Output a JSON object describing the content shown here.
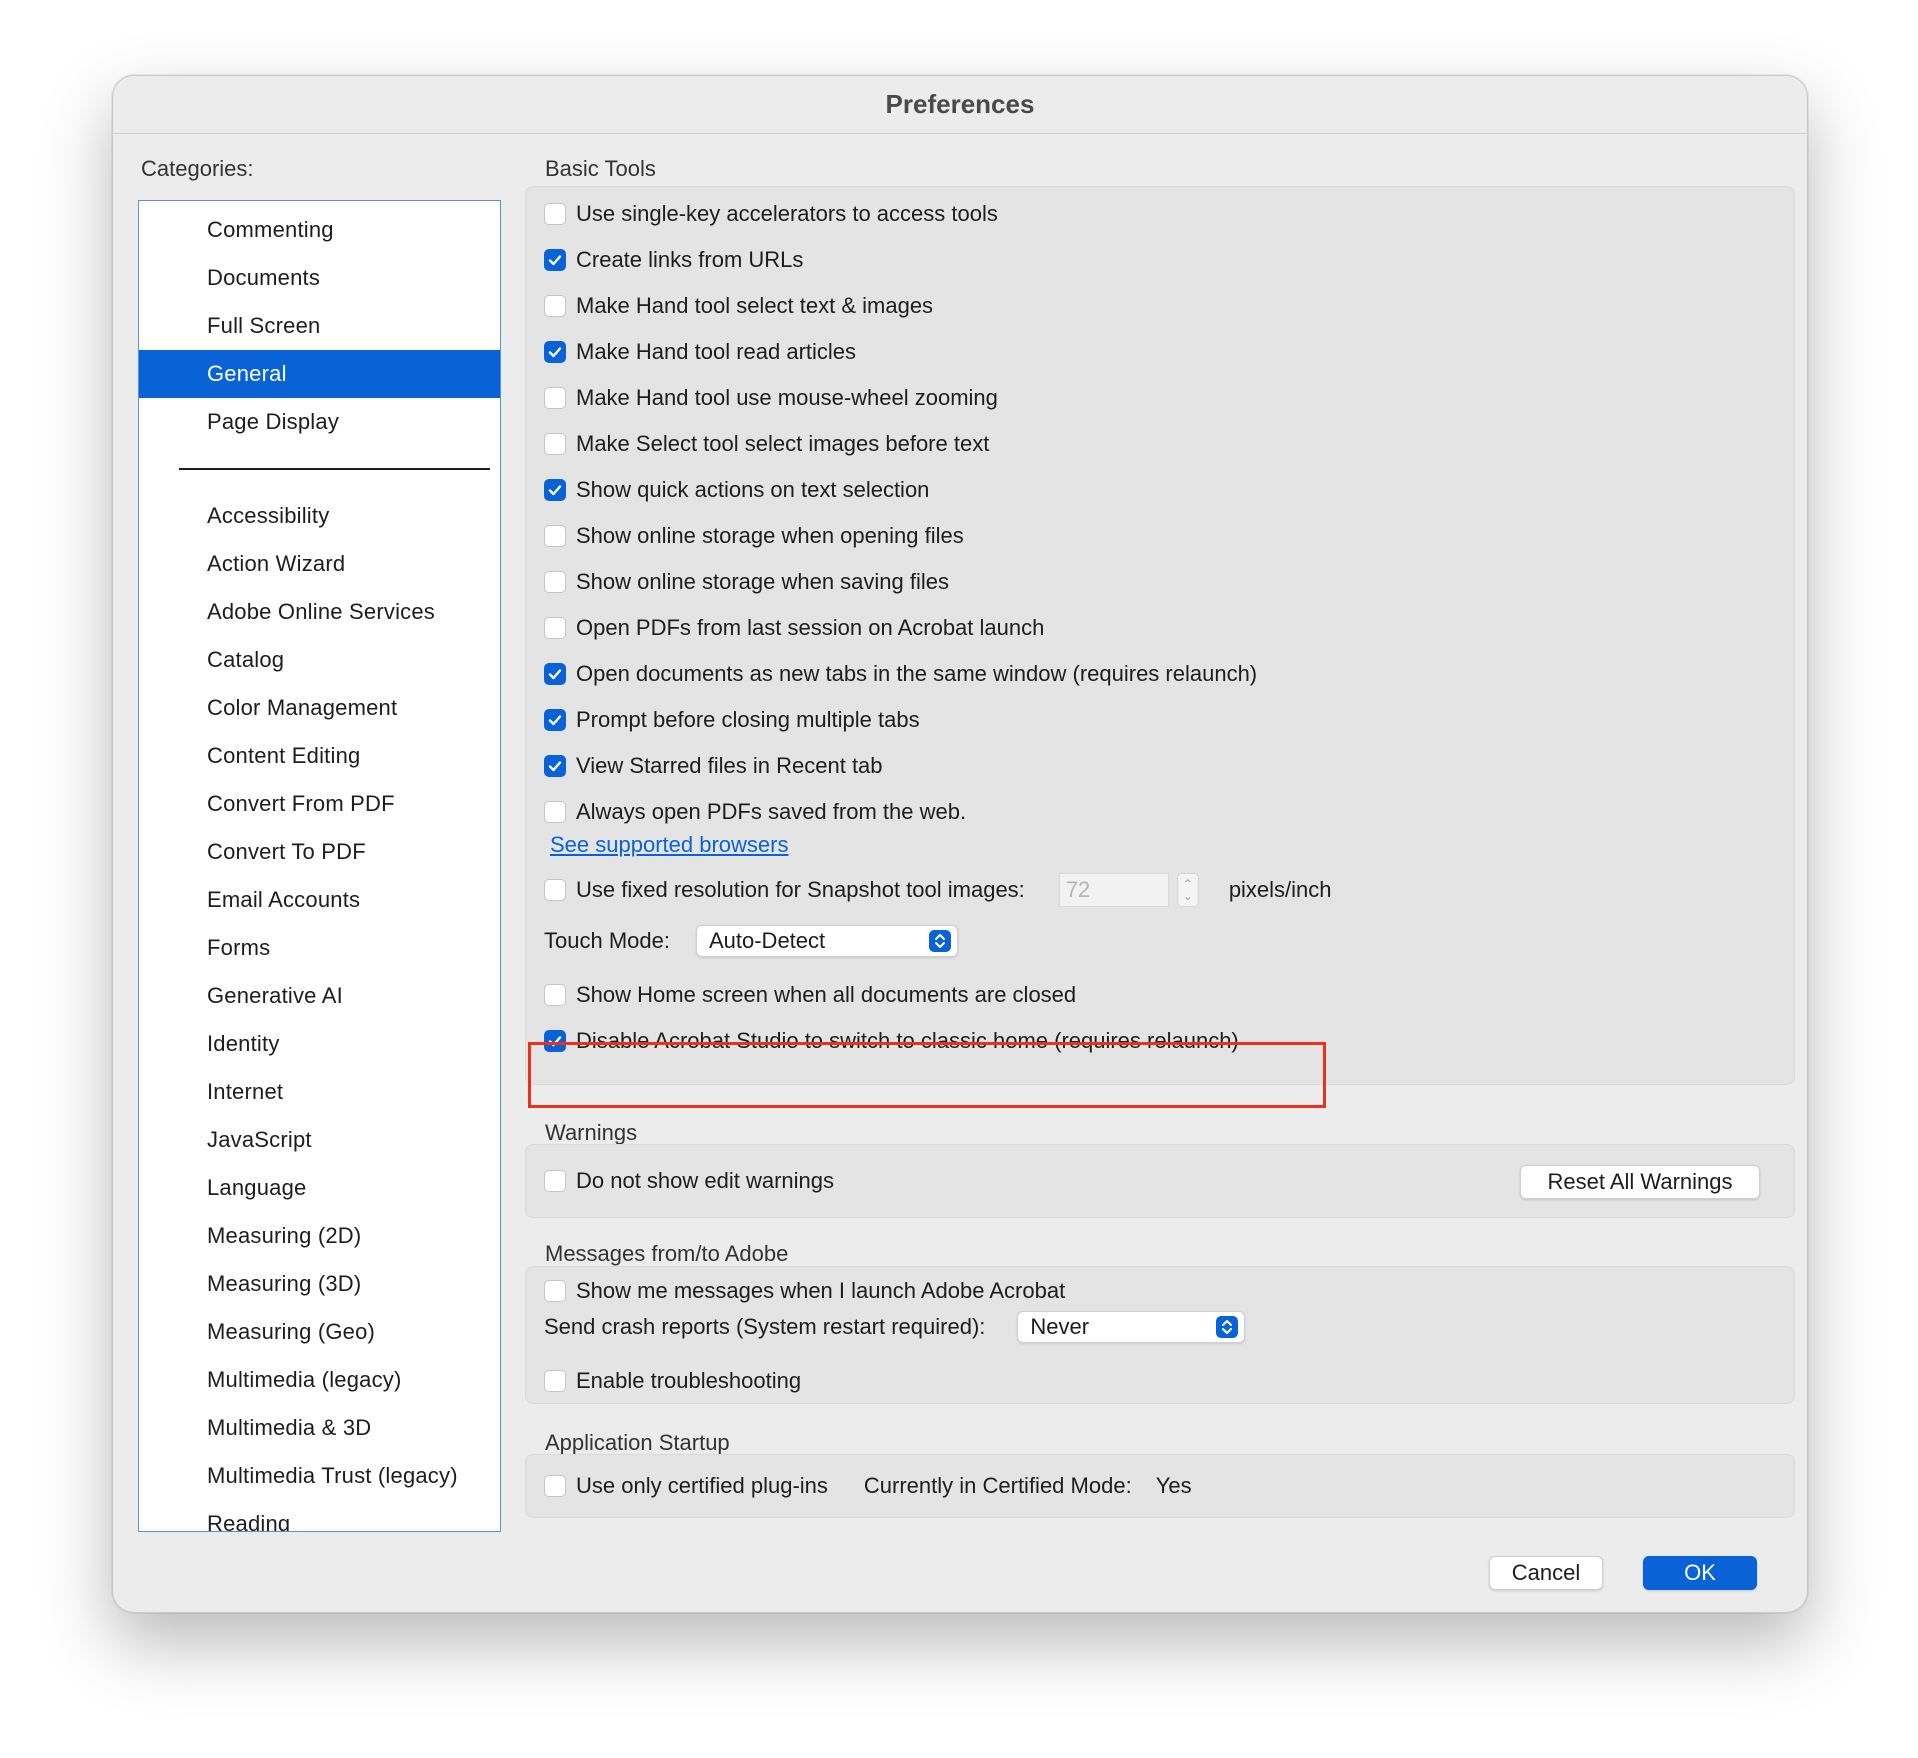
{
  "window": {
    "title": "Preferences"
  },
  "categories": {
    "label": "Categories:",
    "top_items": [
      {
        "label": "Commenting",
        "selected": false
      },
      {
        "label": "Documents",
        "selected": false
      },
      {
        "label": "Full Screen",
        "selected": false
      },
      {
        "label": "General",
        "selected": true
      },
      {
        "label": "Page Display",
        "selected": false
      }
    ],
    "items": [
      {
        "label": "Accessibility"
      },
      {
        "label": "Action Wizard"
      },
      {
        "label": "Adobe Online Services"
      },
      {
        "label": "Catalog"
      },
      {
        "label": "Color Management"
      },
      {
        "label": "Content Editing"
      },
      {
        "label": "Convert From PDF"
      },
      {
        "label": "Convert To PDF"
      },
      {
        "label": "Email Accounts"
      },
      {
        "label": "Forms"
      },
      {
        "label": "Generative AI"
      },
      {
        "label": "Identity"
      },
      {
        "label": "Internet"
      },
      {
        "label": "JavaScript"
      },
      {
        "label": "Language"
      },
      {
        "label": "Measuring (2D)"
      },
      {
        "label": "Measuring (3D)"
      },
      {
        "label": "Measuring (Geo)"
      },
      {
        "label": "Multimedia (legacy)"
      },
      {
        "label": "Multimedia & 3D"
      },
      {
        "label": "Multimedia Trust (legacy)"
      },
      {
        "label": "Reading"
      }
    ]
  },
  "basic_tools": {
    "title": "Basic Tools",
    "options": [
      {
        "label": "Use single-key accelerators to access tools",
        "checked": false
      },
      {
        "label": "Create links from URLs",
        "checked": true
      },
      {
        "label": "Make Hand tool select text & images",
        "checked": false
      },
      {
        "label": "Make Hand tool read articles",
        "checked": true
      },
      {
        "label": "Make Hand tool use mouse-wheel zooming",
        "checked": false
      },
      {
        "label": "Make Select tool select images before text",
        "checked": false
      },
      {
        "label": "Show quick actions on text selection",
        "checked": true
      },
      {
        "label": "Show online storage when opening files",
        "checked": false
      },
      {
        "label": "Show online storage when saving files",
        "checked": false
      },
      {
        "label": "Open PDFs from last session on Acrobat launch",
        "checked": false
      },
      {
        "label": "Open documents as new tabs in the same window (requires relaunch)",
        "checked": true
      },
      {
        "label": "Prompt before closing multiple tabs",
        "checked": true
      },
      {
        "label": "View Starred files in Recent tab",
        "checked": true
      },
      {
        "label": "Always open PDFs saved from the web.",
        "checked": false
      }
    ],
    "browsers_link": "See supported browsers",
    "snapshot": {
      "label": "Use fixed resolution for Snapshot tool images:",
      "checked": false,
      "value": "72",
      "unit": "pixels/inch"
    },
    "touch_mode": {
      "label": "Touch Mode:",
      "value": "Auto-Detect"
    },
    "home_screen": {
      "label": "Show Home screen when all documents are closed",
      "checked": false
    },
    "disable_studio": {
      "label": "Disable Acrobat Studio to switch to classic home (requires relaunch)",
      "checked": true
    }
  },
  "warnings": {
    "title": "Warnings",
    "edit_warnings": {
      "label": "Do not show edit warnings",
      "checked": false
    },
    "reset_button": "Reset All Warnings"
  },
  "messages": {
    "title": "Messages from/to Adobe",
    "show_messages": {
      "label": "Show me messages when I launch Adobe Acrobat",
      "checked": false
    },
    "crash_reports": {
      "label": "Send crash reports (System restart required):",
      "value": "Never"
    },
    "troubleshooting": {
      "label": "Enable troubleshooting",
      "checked": false
    }
  },
  "startup": {
    "title": "Application Startup",
    "certified": {
      "label": "Use only certified plug-ins",
      "checked": false
    },
    "mode_label": "Currently in Certified Mode:",
    "mode_value": "Yes"
  },
  "footer": {
    "cancel": "Cancel",
    "ok": "OK"
  },
  "colors": {
    "accent": "#0a63d6",
    "highlight": "#e8321e"
  }
}
